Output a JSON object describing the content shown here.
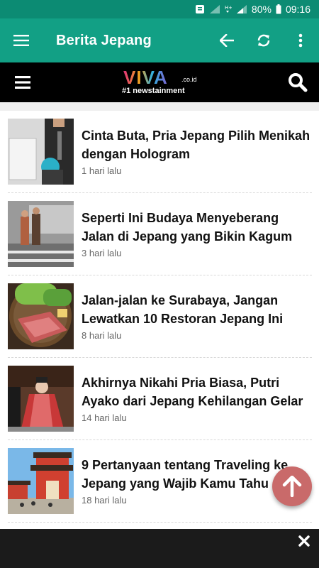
{
  "status_bar": {
    "battery_text": "80%",
    "time": "09:16",
    "icons": [
      "notification-icon",
      "signal-weak-icon",
      "hplus-network-icon",
      "signal-icon",
      "battery-icon"
    ]
  },
  "app_bar": {
    "title": "Berita Jepang",
    "menu_icon": "menu-icon",
    "actions": [
      "back-arrow-icon",
      "refresh-icon",
      "overflow-menu-icon"
    ],
    "color": "#12a085",
    "status_color": "#0c8b73"
  },
  "site_header": {
    "logo_text": "VIVA",
    "logo_suffix": ".co.id",
    "tagline": "#1 newstainment",
    "menu_icon": "hamburger-icon",
    "search_icon": "search-icon"
  },
  "articles": [
    {
      "title": "Cinta Buta, Pria Jepang Pilih Menikah dengan Hologram",
      "time": "1 hari lalu"
    },
    {
      "title": "Seperti Ini Budaya Menyeberang Jalan di Jepang yang Bikin Kagum",
      "time": "3 hari lalu"
    },
    {
      "title": "Jalan-jalan ke Surabaya, Jangan Lewatkan 10 Restoran Jepang Ini",
      "time": "8 hari lalu"
    },
    {
      "title": "Akhirnya Nikahi Pria Biasa, Putri Ayako dari Jepang Kehilangan Gelar",
      "time": "14 hari lalu"
    },
    {
      "title": "9 Pertanyaan tentang Traveling ke Jepang yang Wajib Kamu Tahu",
      "time": "18 hari lalu"
    }
  ],
  "fab": {
    "icon": "arrow-up-icon",
    "color": "#c96a6a"
  },
  "ad_bar": {
    "close_icon": "close-icon"
  }
}
